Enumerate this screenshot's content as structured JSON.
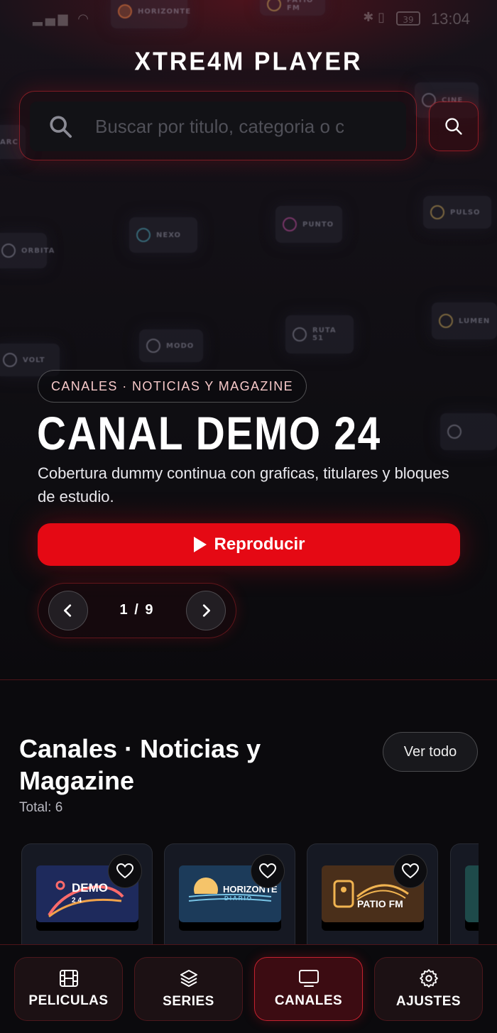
{
  "status_bar": {
    "time": "13:04",
    "battery": "39"
  },
  "app": {
    "title": "XTRE4M PLAYER"
  },
  "search": {
    "placeholder": "Buscar por titulo, categoria o canal"
  },
  "background_tiles": [
    "HORIZONTE",
    "PATIO FM",
    "NEXO",
    "PUNTO",
    "PULSO",
    "ORBITA",
    "MODO",
    "RUTA 51",
    "LUMEN",
    "VOLT",
    "CINE",
    "ARC"
  ],
  "hero": {
    "category": "CANALES · NOTICIAS Y MAGAZINE",
    "title": "CANAL DEMO 24",
    "description": "Cobertura dummy continua con graficas, titulares y bloques de estudio.",
    "play_label": "Reproducir",
    "pager": {
      "current": 1,
      "total": 9,
      "text": "1 / 9"
    }
  },
  "section": {
    "title": "Canales · Noticias y Magazine",
    "total": "Total: 6",
    "see_all": "Ver todo",
    "cards": [
      {
        "logo": "DEMO",
        "sub": "24",
        "color": "#1e2a5c"
      },
      {
        "logo": "HORIZONTE",
        "sub": "DIARIO",
        "color": "#1c3b5a"
      },
      {
        "logo": "PATIO FM",
        "sub": "",
        "color": "#4a2f1a"
      },
      {
        "logo": "",
        "sub": "",
        "color": "#1e4a4a"
      }
    ]
  },
  "bottom_nav": [
    {
      "label": "PELICULAS",
      "icon": "film-icon"
    },
    {
      "label": "SERIES",
      "icon": "layers-icon"
    },
    {
      "label": "CANALES",
      "icon": "tv-icon",
      "active": true
    },
    {
      "label": "AJUSTES",
      "icon": "gear-icon"
    }
  ],
  "colors": {
    "accent": "#e50914",
    "background": "#0b0a0d"
  }
}
